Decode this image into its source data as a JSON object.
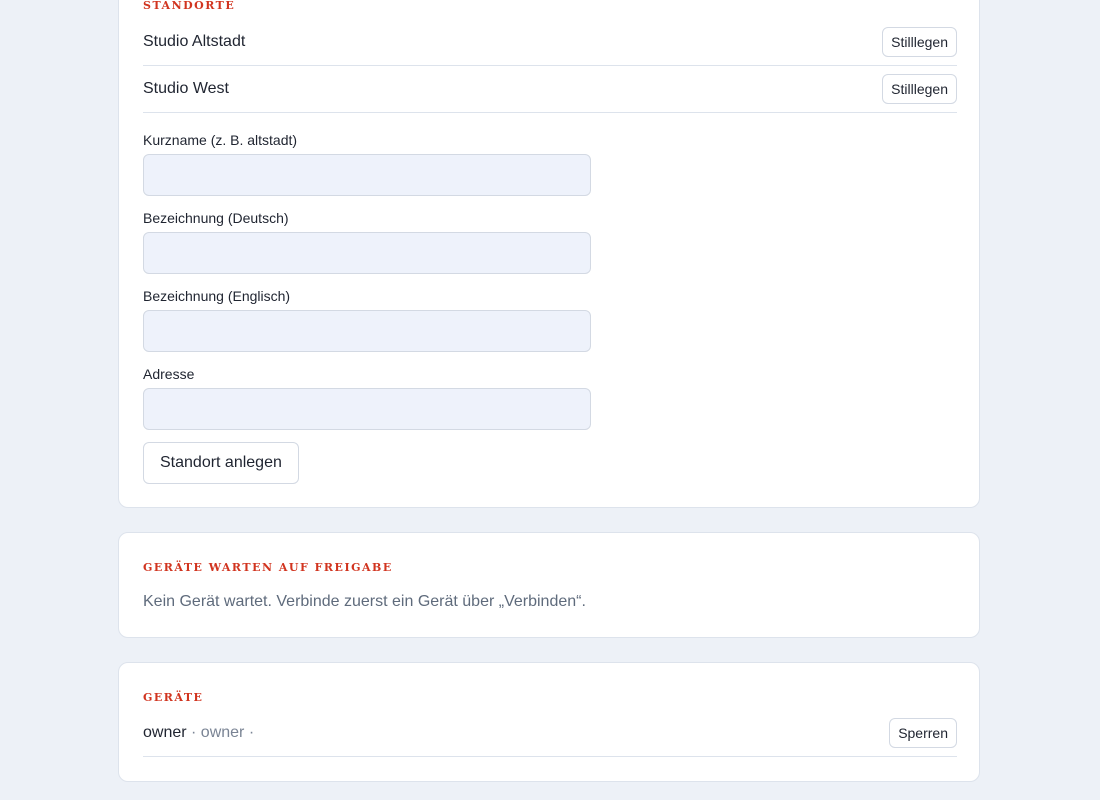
{
  "standorte": {
    "title": "Standorte",
    "locations": [
      {
        "name": "Studio Altstadt",
        "action_label": "Stilllegen"
      },
      {
        "name": "Studio West",
        "action_label": "Stilllegen"
      }
    ],
    "form": {
      "shortname_label": "Kurzname (z. B. altstadt)",
      "shortname_value": "",
      "name_de_label": "Bezeichnung (Deutsch)",
      "name_de_value": "",
      "name_en_label": "Bezeichnung (Englisch)",
      "name_en_value": "",
      "address_label": "Adresse",
      "address_value": "",
      "submit_label": "Standort anlegen"
    }
  },
  "pending": {
    "title": "Geräte warten auf Freigabe",
    "empty_text": "Kein Gerät wartet. Verbinde zuerst ein Gerät über „Verbinden“."
  },
  "devices": {
    "title": "Geräte",
    "items": [
      {
        "name": "owner",
        "meta": " · owner ·",
        "action_label": "Sperren"
      }
    ]
  },
  "colors": {
    "accent": "#d1341f",
    "background": "#edf1f7",
    "input_background": "#eef2fb"
  }
}
